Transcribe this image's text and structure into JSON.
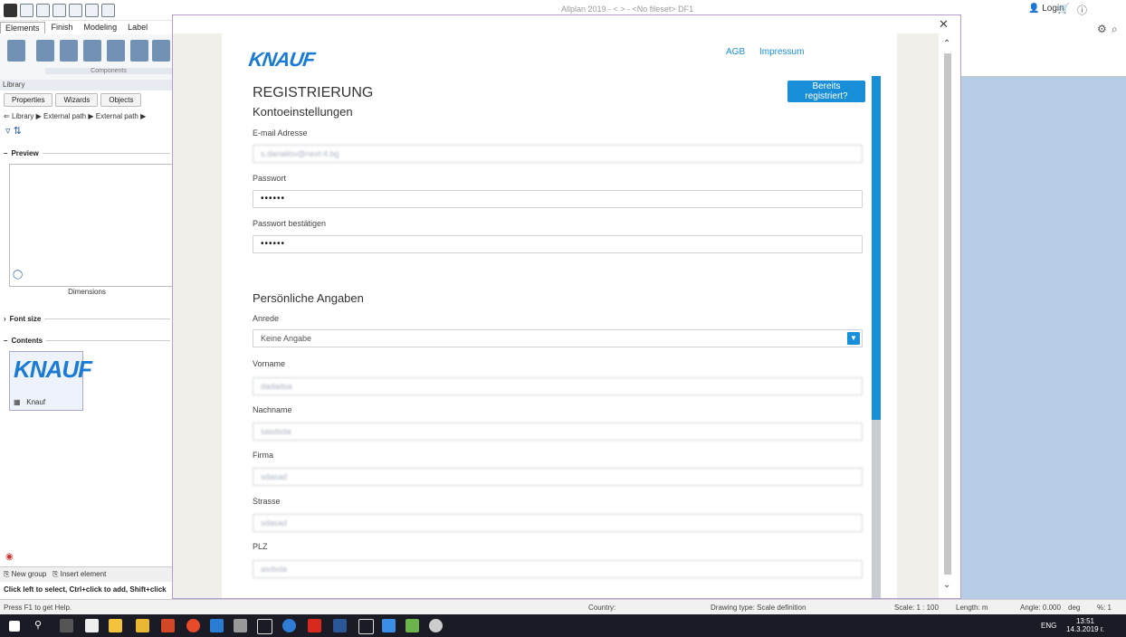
{
  "app": {
    "title": "Allplan 2019 - <  > - <No fileset> DF1",
    "login": "Login",
    "ribbon_tabs": [
      "Elements",
      "Finish",
      "Modeling",
      "Label"
    ],
    "ribbon_group": "Components"
  },
  "library": {
    "header": "Library",
    "tabs": [
      "Properties",
      "Wizards",
      "Objects"
    ],
    "path": "Library ▶ External path ▶ External path ▶",
    "preview_label": "Preview",
    "dimensions_label": "Dimensions",
    "font_size_label": "Font size",
    "contents_label": "Contents",
    "tile_name": "Knauf",
    "tile_logo": "KNAUF",
    "new_group": "New group",
    "insert_element": "Insert element",
    "hint": "Click left to select, Ctrl+click to add, Shift+click"
  },
  "dialog": {
    "logo": "KNAUF",
    "links": {
      "agb": "AGB",
      "impressum": "Impressum"
    },
    "registered_button": "Bereits registriert?",
    "title": "REGISTRIERUNG",
    "account_section": "Kontoeinstellungen",
    "personal_section": "Persönliche Angaben",
    "fields": {
      "email": {
        "label": "E-mail Adresse",
        "value": "s.danailov@next-it.bg"
      },
      "password": {
        "label": "Passwort",
        "value": "••••••"
      },
      "password_confirm": {
        "label": "Passwort bestätigen",
        "value": "••••••"
      },
      "anrede": {
        "label": "Anrede",
        "value": "Keine Angabe"
      },
      "vorname": {
        "label": "Vorname",
        "value": "dadadsa"
      },
      "nachname": {
        "label": "Nachname",
        "value": "sasdsda"
      },
      "firma": {
        "label": "Firma",
        "value": "sdasad"
      },
      "strasse": {
        "label": "Strasse",
        "value": "sdasad"
      },
      "plz": {
        "label": "PLZ",
        "value": "asdsda"
      }
    }
  },
  "statusbar": {
    "help": "Press F1 to get Help.",
    "country": "Country:",
    "drawing_type": "Drawing type: Scale definition",
    "scale": "Scale: 1 : 100",
    "length": "Length: m",
    "angle": "Angle: 0.000",
    "angle_unit": "deg",
    "percent": "%: 1"
  },
  "taskbar": {
    "language": "ENG",
    "time": "13:51",
    "date": "14.3.2019 г."
  },
  "colors": {
    "accent": "#1a8fd9",
    "brand": "#1a7bd4",
    "canvas": "#b7cde6"
  }
}
